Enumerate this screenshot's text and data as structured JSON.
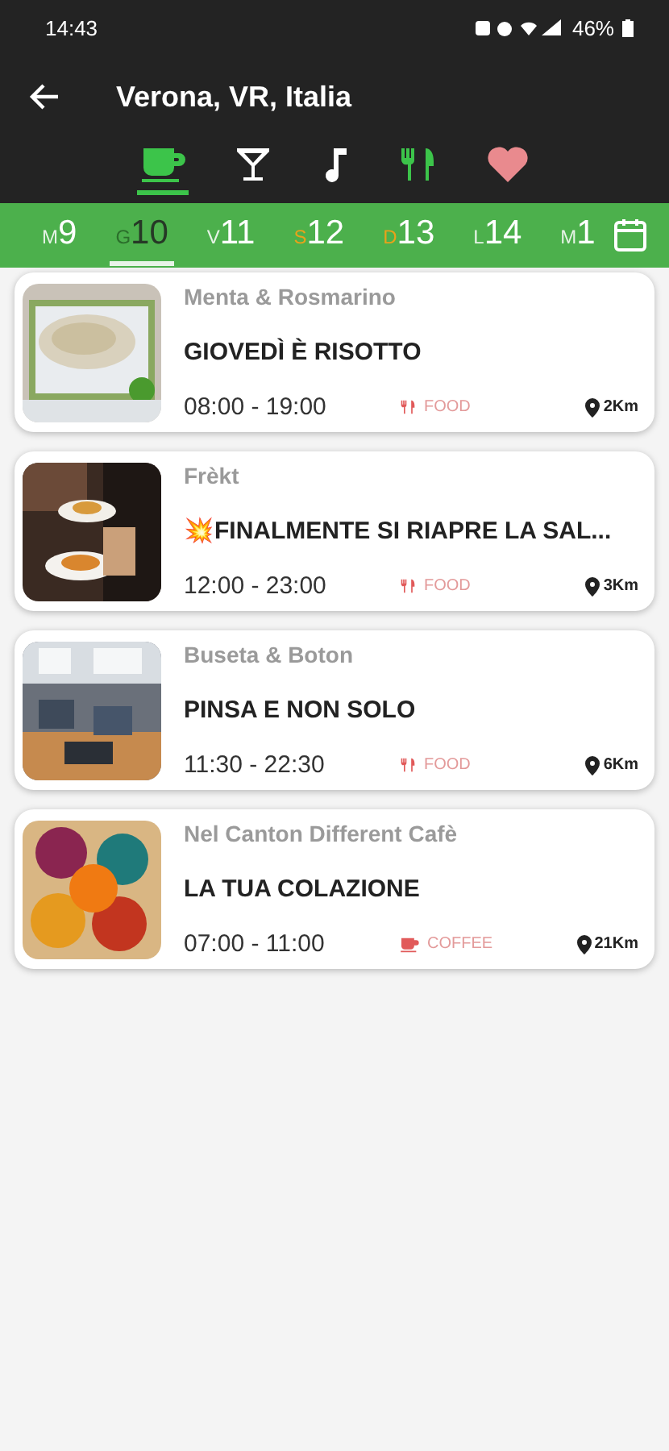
{
  "status_bar": {
    "time": "14:43",
    "battery": "46%"
  },
  "header": {
    "title": "Verona, VR, Italia"
  },
  "categories": [
    {
      "kind": "coffee",
      "selected": true,
      "color": "#3cc44a"
    },
    {
      "kind": "cocktail",
      "selected": false,
      "color": "#ffffff"
    },
    {
      "kind": "music",
      "selected": false,
      "color": "#ffffff"
    },
    {
      "kind": "food",
      "selected": false,
      "color": "#3cc44a"
    },
    {
      "kind": "favorites",
      "selected": false,
      "color": "#e98a8e"
    }
  ],
  "days": [
    {
      "letter": "M",
      "number": "9",
      "selected": false,
      "color": "#e6f3e6"
    },
    {
      "letter": "G",
      "number": "10",
      "selected": true,
      "color": "#2b6e2b"
    },
    {
      "letter": "V",
      "number": "11",
      "selected": false,
      "color": "#e6f3e6"
    },
    {
      "letter": "S",
      "number": "12",
      "selected": false,
      "color": "#e8a21a"
    },
    {
      "letter": "D",
      "number": "13",
      "selected": false,
      "color": "#e8a21a"
    },
    {
      "letter": "L",
      "number": "14",
      "selected": false,
      "color": "#e6f3e6"
    },
    {
      "letter": "M",
      "number": "1",
      "selected": false,
      "color": "#e6f3e6"
    }
  ],
  "events": [
    {
      "venue": "Menta & Rosmarino",
      "title": "GIOVEDÌ È RISOTTO",
      "hours": "08:00 - 19:00",
      "kind": "food",
      "category": "FOOD",
      "distance": "2Km"
    },
    {
      "venue": "Frèkt",
      "title": "💥FINALMENTE SI RIAPRE LA SAL...",
      "hours": "12:00 - 23:00",
      "kind": "food",
      "category": "FOOD",
      "distance": "3Km"
    },
    {
      "venue": "Buseta & Boton",
      "title": "PINSA E NON SOLO",
      "hours": "11:30 - 22:30",
      "kind": "food",
      "category": "FOOD",
      "distance": "6Km"
    },
    {
      "venue": "Nel Canton Different Cafè",
      "title": "LA TUA COLAZIONE",
      "hours": "07:00 - 11:00",
      "kind": "coffee",
      "category": "COFFEE",
      "distance": "21Km"
    }
  ]
}
